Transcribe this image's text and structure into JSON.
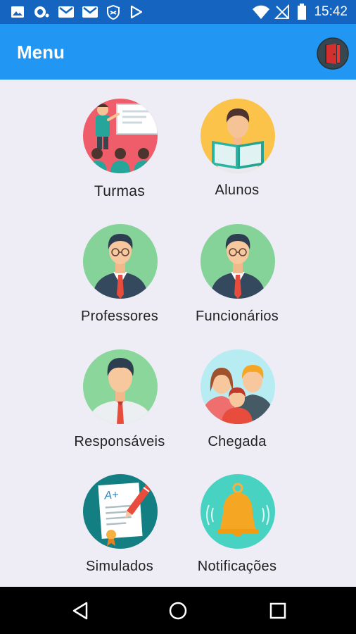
{
  "status_bar": {
    "time": "15:42",
    "left_icons": [
      "image-icon",
      "sync-icon",
      "mail-icon",
      "mail-icon",
      "shield-icon",
      "play-store-icon"
    ],
    "right_icons": [
      "wifi-icon",
      "no-signal-icon",
      "battery-icon"
    ]
  },
  "app_bar": {
    "title": "Menu",
    "action_icon": "logout-door-icon"
  },
  "menu": {
    "items": [
      {
        "label": "Turmas",
        "icon": "classroom-icon"
      },
      {
        "label": "Alunos",
        "icon": "student-reading-icon"
      },
      {
        "label": "Professores",
        "icon": "teacher-icon"
      },
      {
        "label": "Funcionários",
        "icon": "employee-icon"
      },
      {
        "label": "Responsáveis",
        "icon": "guardian-icon"
      },
      {
        "label": "Chegada",
        "icon": "family-icon"
      },
      {
        "label": "Simulados",
        "icon": "exam-icon"
      },
      {
        "label": "Notificações",
        "icon": "bell-icon"
      }
    ]
  },
  "nav_bar": {
    "buttons": [
      "back-icon",
      "home-icon",
      "recents-icon"
    ]
  },
  "colors": {
    "status_bar": "#1565c0",
    "app_bar": "#2196f3",
    "background": "#eeedf6",
    "nav_bar": "#000000"
  }
}
